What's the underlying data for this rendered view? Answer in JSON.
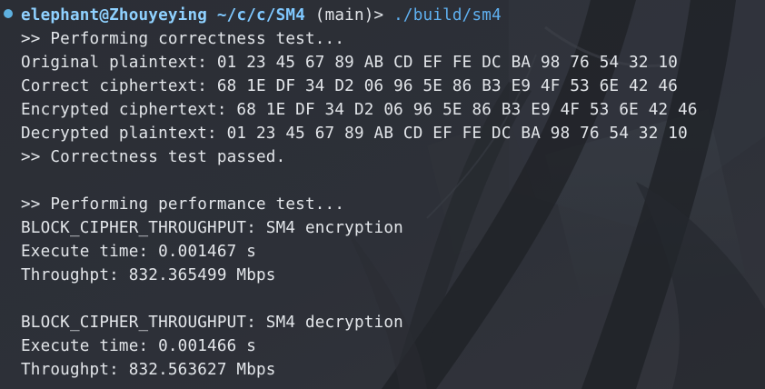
{
  "prompt": {
    "user_host": "elephant@Zhouyeying",
    "path": "~/c/c/SM4",
    "branch": "(main)>",
    "command": "./build/sm4"
  },
  "output_lines": [
    ">> Performing correctness test...",
    "Original plaintext: 01 23 45 67 89 AB CD EF FE DC BA 98 76 54 32 10",
    "Correct ciphertext: 68 1E DF 34 D2 06 96 5E 86 B3 E9 4F 53 6E 42 46",
    "Encrypted ciphertext: 68 1E DF 34 D2 06 96 5E 86 B3 E9 4F 53 6E 42 46",
    "Decrypted plaintext: 01 23 45 67 89 AB CD EF FE DC BA 98 76 54 32 10",
    ">> Correctness test passed.",
    "",
    ">> Performing performance test...",
    "BLOCK_CIPHER_THROUGHPUT: SM4 encryption",
    "Execute time: 0.001467 s",
    "Throughpt: 832.365499 Mbps",
    "",
    "BLOCK_CIPHER_THROUGHPUT: SM4 decryption",
    "Execute time: 0.001466 s",
    "Throughpt: 832.563627 Mbps"
  ],
  "colors": {
    "background": "#2a2d34",
    "text": "#e3e6ea",
    "prompt_user": "#8fd1ff",
    "prompt_path": "#7fc8ff",
    "command": "#5fb0f0",
    "status_dot": "#5eb1e0"
  },
  "icons": {
    "status": "status-dot-icon"
  }
}
